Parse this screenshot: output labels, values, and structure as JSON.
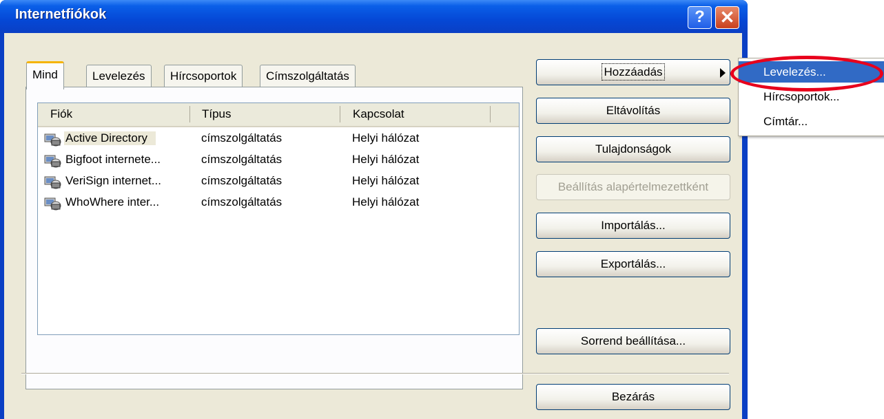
{
  "window": {
    "title": "Internetfiókok",
    "help_label": "?",
    "close_label": "✕"
  },
  "tabs": [
    {
      "label": "Mind",
      "active": true
    },
    {
      "label": "Levelezés",
      "active": false
    },
    {
      "label": "Hírcsoportok",
      "active": false
    },
    {
      "label": "Címszolgáltatás",
      "active": false
    }
  ],
  "list": {
    "columns": [
      "Fiók",
      "Típus",
      "Kapcsolat"
    ],
    "rows": [
      {
        "account": "Active Directory",
        "type": "címszolgáltatás",
        "connection": "Helyi hálózat",
        "icon": "directory-service-icon",
        "selected": true
      },
      {
        "account": "Bigfoot internete...",
        "type": "címszolgáltatás",
        "connection": "Helyi hálózat",
        "icon": "directory-service-icon",
        "selected": false
      },
      {
        "account": "VeriSign internet...",
        "type": "címszolgáltatás",
        "connection": "Helyi hálózat",
        "icon": "directory-service-icon",
        "selected": false
      },
      {
        "account": "WhoWhere inter...",
        "type": "címszolgáltatás",
        "connection": "Helyi hálózat",
        "icon": "directory-service-icon",
        "selected": false
      }
    ]
  },
  "buttons": {
    "add": "Hozzáadás",
    "remove": "Eltávolítás",
    "properties": "Tulajdonságok",
    "set_default": "Beállítás alapértelmezettként",
    "import": "Importálás...",
    "export": "Exportálás...",
    "set_order": "Sorrend beállítása...",
    "close": "Bezárás"
  },
  "add_menu": {
    "items": [
      "Levelezés...",
      "Hírcsoportok...",
      "Címtár..."
    ],
    "highlighted": "Levelezés..."
  },
  "colors": {
    "titlebar": "#0a5fe8",
    "menu_highlight": "#316ac5",
    "annotation_ellipse": "#e8001c",
    "tab_active_accent": "#f5b400"
  }
}
